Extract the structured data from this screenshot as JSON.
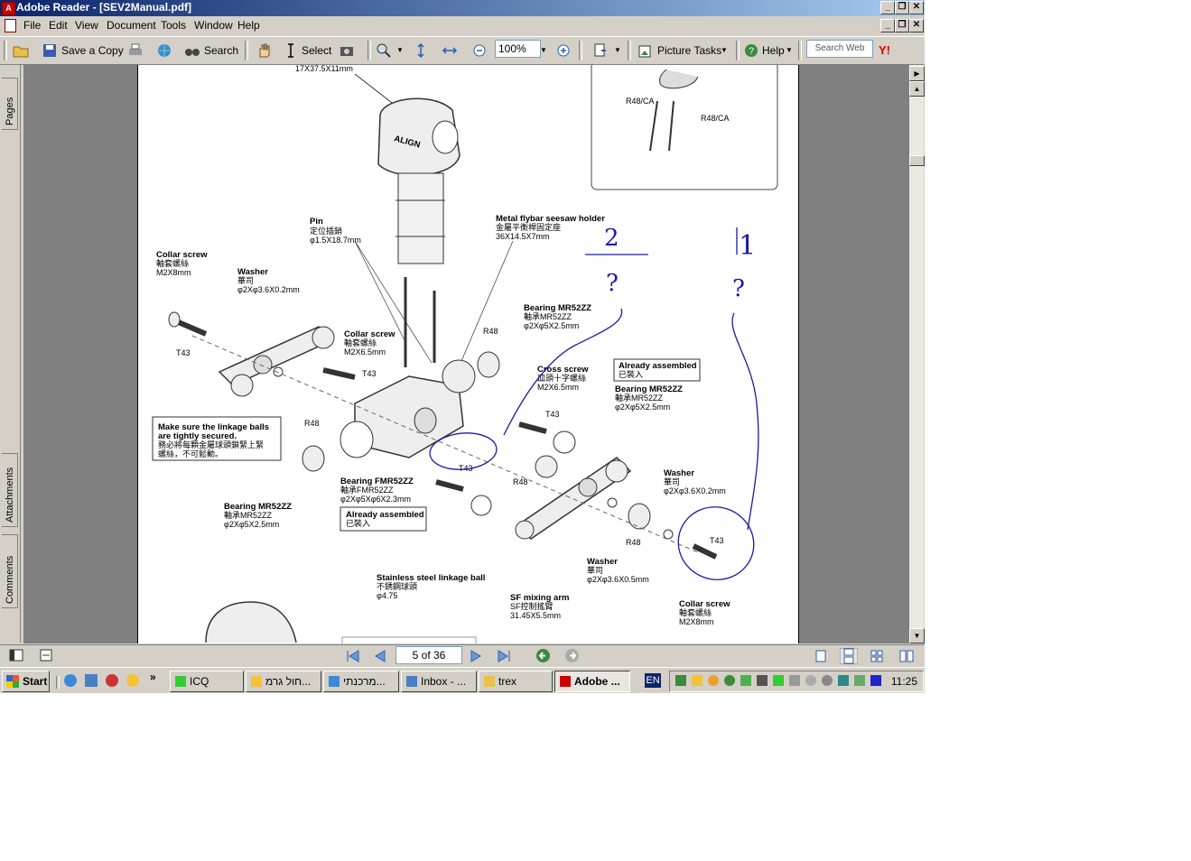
{
  "window": {
    "title": "Adobe Reader - [SEV2Manual.pdf]"
  },
  "menu": [
    "File",
    "Edit",
    "View",
    "Document",
    "Tools",
    "Window",
    "Help"
  ],
  "toolbar": {
    "save_copy": "Save a Copy",
    "search": "Search",
    "select": "Select",
    "zoom": "100%",
    "picture_tasks": "Picture Tasks",
    "help": "Help",
    "search_web_placeholder": "Search Web"
  },
  "side_tabs": [
    "Pages",
    "Attachments",
    "Comments"
  ],
  "document": {
    "labels": {
      "top_dim": "17X37.5X11mm",
      "pin_t": "Pin",
      "pin_c": "定位插銷",
      "pin_d": "φ1.5X18.7mm",
      "metal_t": "Metal flybar seesaw holder",
      "metal_c": "金屬平衡桿固定座",
      "metal_d": "36X14.5X7mm",
      "collar1_t": "Collar screw",
      "collar1_c": "軸套螺絲",
      "collar1_d": "M2X8mm",
      "washer1_t": "Washer",
      "washer1_c": "華司",
      "washer1_d": "φ2Xφ3.6X0.2mm",
      "collar2_t": "Collar screw",
      "collar2_c": "軸套螺絲",
      "collar2_d": "M2X6.5mm",
      "bearing1_t": "Bearing MR52ZZ",
      "bearing1_c": "軸承MR52ZZ",
      "bearing1_d": "φ2Xφ5X2.5mm",
      "cross_t": "Cross screw",
      "cross_c": "皿頭十字螺絲",
      "cross_d": "M2X6.5mm",
      "already1_t": "Already assembled",
      "already1_c": "已裝入",
      "bearing2_t": "Bearing MR52ZZ",
      "bearing2_c": "軸承MR52ZZ",
      "bearing2_d": "φ2Xφ5X2.5mm",
      "note_t1": "Make sure the linkage balls",
      "note_t2": "are tightly secured.",
      "note_c1": "務必將每顆金屬球頭鎖緊上緊",
      "note_c2": "螺絲，不可鬆動。",
      "bearingF_t": "Bearing FMR52ZZ",
      "bearingF_c": "軸承FMR52ZZ",
      "bearingF_d": "φ2Xφ5Xφ6X2.3mm",
      "already2_t": "Already assembled",
      "already2_c": "已裝入",
      "bearing3_t": "Bearing MR52ZZ",
      "bearing3_c": "軸承MR52ZZ",
      "bearing3_d": "φ2Xφ5X2.5mm",
      "washer2_t": "Washer",
      "washer2_c": "華司",
      "washer2_d": "φ2Xφ3.6X0.2mm",
      "washer3_t": "Washer",
      "washer3_c": "華司",
      "washer3_d": "φ2Xφ3.6X0.5mm",
      "ssball_t": "Stainless steel linkage ball",
      "ssball_c": "不銹鋼球頭",
      "ssball_d": "φ4.75",
      "sfarm_t": "SF mixing arm",
      "sfarm_c": "SF控制搖臂",
      "sfarm_d": "31.45X5.5mm",
      "collar3_t": "Collar screw",
      "collar3_c": "軸套螺絲",
      "collar3_d": "M2X8mm",
      "r48ca": "R48/CA",
      "t43": "T43",
      "r48": "R48",
      "align": "ALIGN",
      "hand_2": "2",
      "hand_1": "1",
      "hand_q": "?"
    }
  },
  "nav": {
    "page_indicator": "5 of 36"
  },
  "taskbar": {
    "start": "Start",
    "items": [
      "ICQ",
      "חול גרמ...",
      "מרכנתי...",
      "Inbox - ...",
      "trex",
      "Adobe ..."
    ],
    "lang": "EN",
    "clock": "11:25"
  }
}
